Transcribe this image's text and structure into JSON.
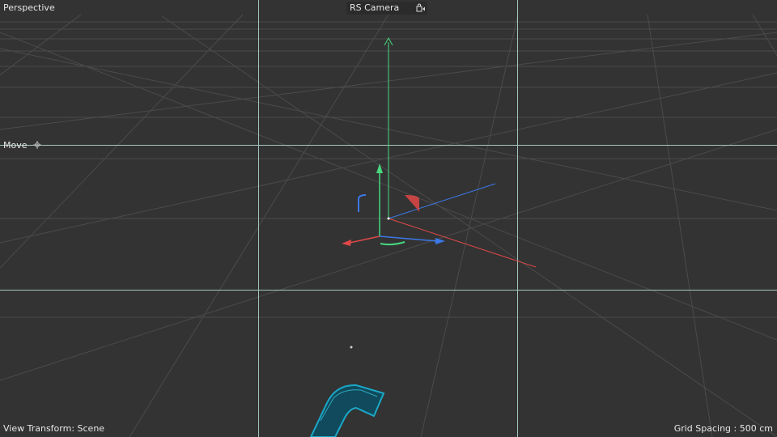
{
  "viewport": {
    "view_name": "Perspective",
    "camera": {
      "name": "RS Camera",
      "icon": "camera-lock-icon"
    },
    "tool": {
      "label": "Move",
      "icon": "move-icon"
    },
    "view_transform": "View Transform: Scene",
    "grid_spacing": "Grid Spacing : 500 cm"
  },
  "colors": {
    "background": "#333333",
    "grid_line": "#4a4a4a",
    "safe_frame": "#b8e0d8",
    "x_axis": "#e04848",
    "y_axis": "#48d880",
    "z_axis": "#3c78e8",
    "object": "#1aa8c8"
  }
}
